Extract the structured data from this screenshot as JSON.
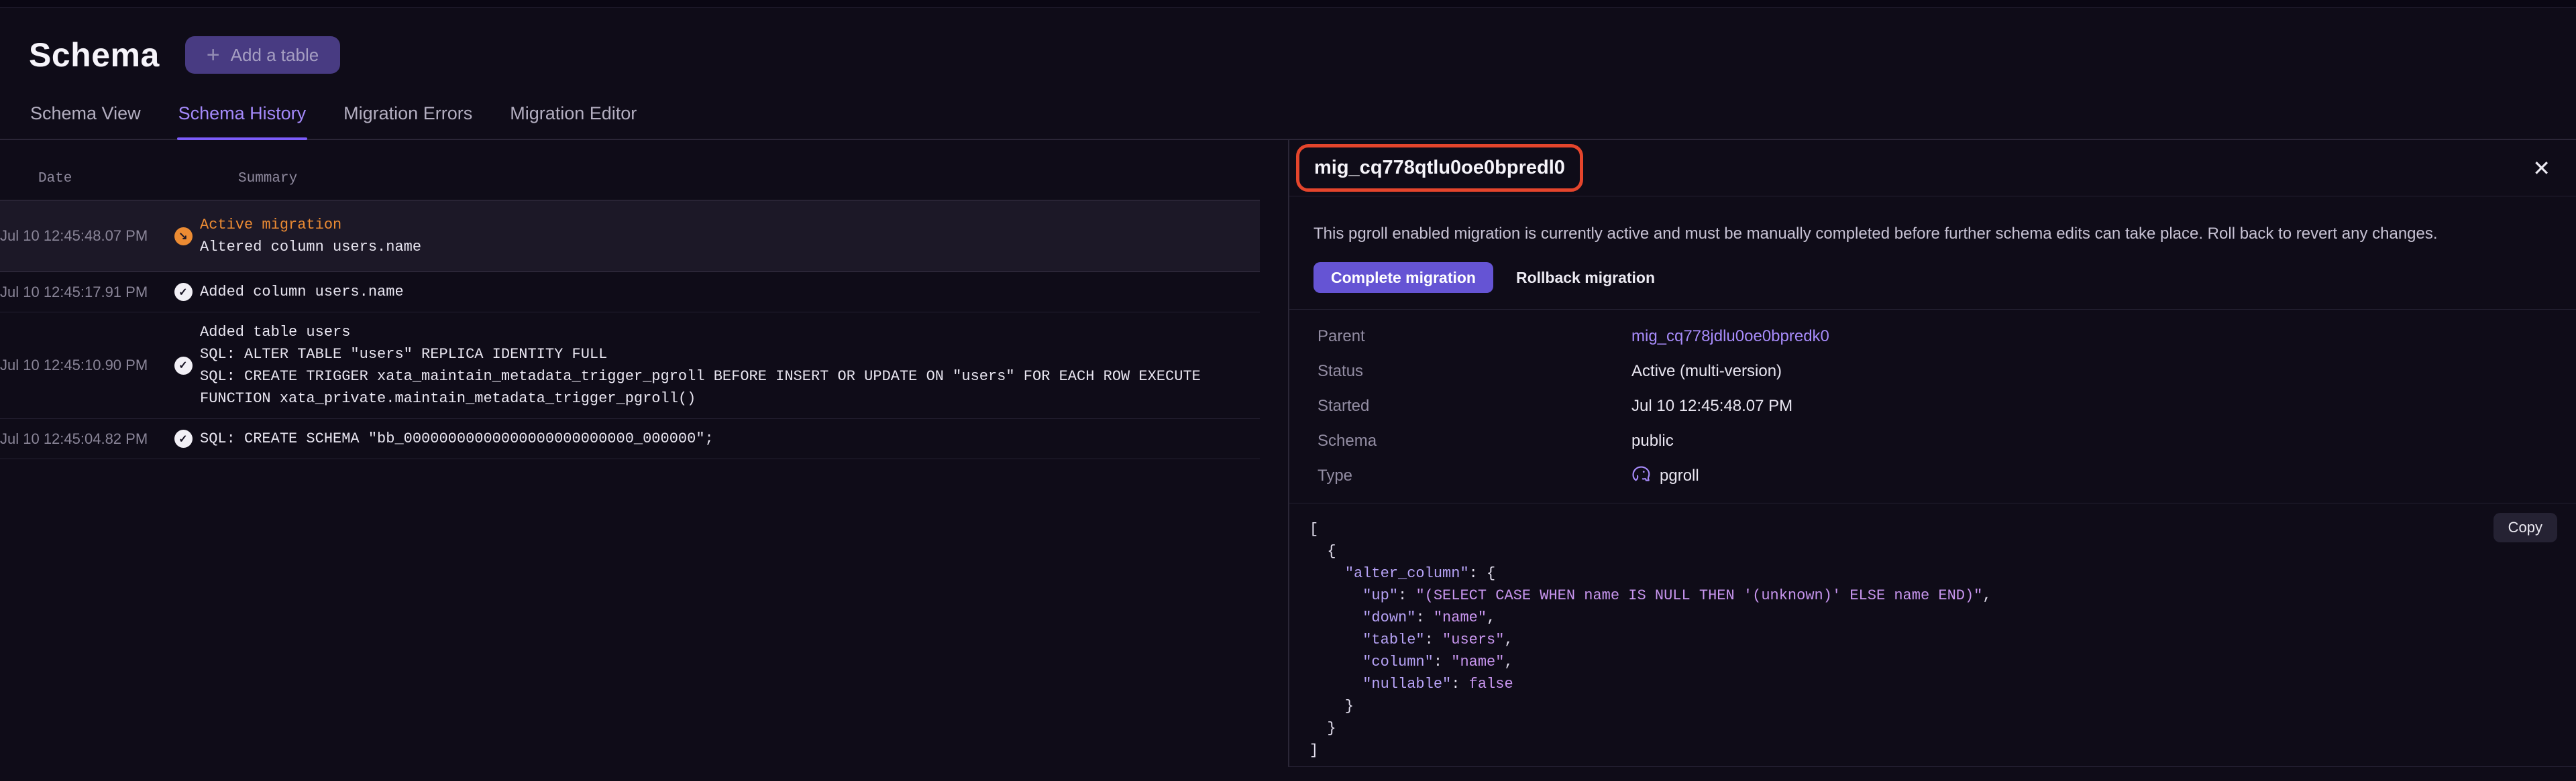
{
  "page": {
    "title": "Schema",
    "add_table_label": "Add a table"
  },
  "tabs": [
    {
      "label": "Schema View",
      "active": false
    },
    {
      "label": "Schema History",
      "active": true
    },
    {
      "label": "Migration Errors",
      "active": false
    },
    {
      "label": "Migration Editor",
      "active": false
    }
  ],
  "history_table": {
    "columns": [
      "Date",
      "Summary"
    ],
    "rows": [
      {
        "date": "Jul 10 12:45:48.07 PM",
        "icon": "active-arrow",
        "status_label": "Active migration",
        "lines": [
          "Altered column users.name"
        ],
        "selected": true
      },
      {
        "date": "Jul 10 12:45:17.91 PM",
        "icon": "check",
        "lines": [
          "Added column users.name"
        ],
        "selected": false
      },
      {
        "date": "Jul 10 12:45:10.90 PM",
        "icon": "check",
        "lines": [
          "Added table users",
          "SQL: ALTER TABLE \"users\" REPLICA IDENTITY FULL",
          "SQL: CREATE TRIGGER xata_maintain_metadata_trigger_pgroll BEFORE INSERT OR UPDATE ON \"users\" FOR EACH ROW EXECUTE FUNCTION xata_private.maintain_metadata_trigger_pgroll()"
        ],
        "selected": false
      },
      {
        "date": "Jul 10 12:45:04.82 PM",
        "icon": "check",
        "lines": [
          "SQL: CREATE SCHEMA \"bb_00000000000000000000000000_000000\";"
        ],
        "selected": false
      }
    ]
  },
  "detail_panel": {
    "migration_id": "mig_cq778qtlu0oe0bpredl0",
    "description": "This pgroll enabled migration is currently active and must be manually completed before further schema edits can take place. Roll back to revert any changes.",
    "actions": {
      "complete": "Complete migration",
      "rollback": "Rollback migration"
    },
    "fields": [
      {
        "label": "Parent",
        "value": "mig_cq778jdlu0oe0bpredk0",
        "type": "link"
      },
      {
        "label": "Status",
        "value": "Active (multi-version)",
        "type": "text"
      },
      {
        "label": "Started",
        "value": "Jul 10 12:45:48.07 PM",
        "type": "text"
      },
      {
        "label": "Schema",
        "value": "public",
        "type": "text"
      },
      {
        "label": "Type",
        "value": "pgroll",
        "type": "pgroll"
      }
    ],
    "copy_label": "Copy",
    "code_lines": [
      [
        {
          "t": "p",
          "s": "["
        }
      ],
      [
        {
          "t": "p",
          "s": "  {"
        }
      ],
      [
        {
          "t": "p",
          "s": "    "
        },
        {
          "t": "k",
          "s": "\"alter_column\""
        },
        {
          "t": "p",
          "s": ": {"
        }
      ],
      [
        {
          "t": "p",
          "s": "      "
        },
        {
          "t": "k",
          "s": "\"up\""
        },
        {
          "t": "p",
          "s": ": "
        },
        {
          "t": "s",
          "s": "\"(SELECT CASE WHEN name IS NULL THEN '(unknown)' ELSE name END)\""
        },
        {
          "t": "p",
          "s": ","
        }
      ],
      [
        {
          "t": "p",
          "s": "      "
        },
        {
          "t": "k",
          "s": "\"down\""
        },
        {
          "t": "p",
          "s": ": "
        },
        {
          "t": "s",
          "s": "\"name\""
        },
        {
          "t": "p",
          "s": ","
        }
      ],
      [
        {
          "t": "p",
          "s": "      "
        },
        {
          "t": "k",
          "s": "\"table\""
        },
        {
          "t": "p",
          "s": ": "
        },
        {
          "t": "s",
          "s": "\"users\""
        },
        {
          "t": "p",
          "s": ","
        }
      ],
      [
        {
          "t": "p",
          "s": "      "
        },
        {
          "t": "k",
          "s": "\"column\""
        },
        {
          "t": "p",
          "s": ": "
        },
        {
          "t": "s",
          "s": "\"name\""
        },
        {
          "t": "p",
          "s": ","
        }
      ],
      [
        {
          "t": "p",
          "s": "      "
        },
        {
          "t": "k",
          "s": "\"nullable\""
        },
        {
          "t": "p",
          "s": ": "
        },
        {
          "t": "b",
          "s": "false"
        }
      ],
      [
        {
          "t": "p",
          "s": "    }"
        }
      ],
      [
        {
          "t": "p",
          "s": "  }"
        }
      ],
      [
        {
          "t": "p",
          "s": "]"
        }
      ]
    ]
  },
  "colors": {
    "accent_purple": "#7c5cfa",
    "link_purple": "#a78bfa",
    "active_orange": "#ec8b33",
    "annotation_red": "#e5452c",
    "primary_button": "#6554d4",
    "background": "#0f0c18"
  },
  "icons": {
    "plus": "plus-icon",
    "close": "close-icon",
    "active": "active-migration-arrow-icon",
    "check": "completed-check-icon",
    "pgroll": "pgroll-elephant-icon"
  }
}
